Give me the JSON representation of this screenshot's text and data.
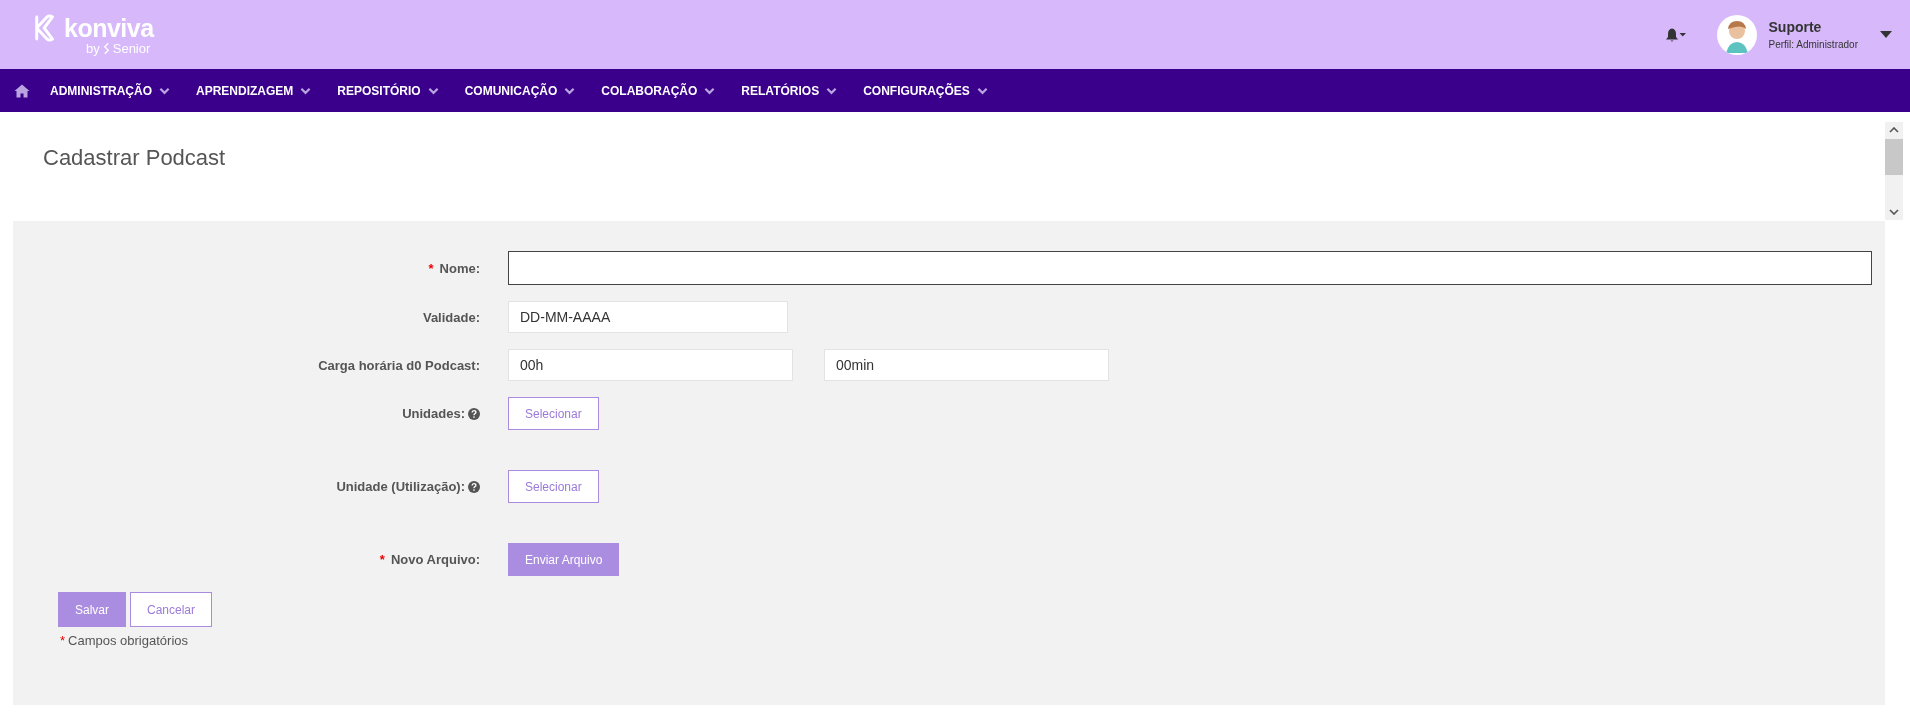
{
  "header": {
    "logo": {
      "name": "konviva",
      "by": "by",
      "brand": "Senior"
    },
    "user": {
      "name": "Suporte",
      "profile": "Perfil: Administrador"
    }
  },
  "nav": {
    "items": [
      {
        "label": "ADMINISTRAÇÃO"
      },
      {
        "label": "APRENDIZAGEM"
      },
      {
        "label": "REPOSITÓRIO"
      },
      {
        "label": "COMUNICAÇÃO"
      },
      {
        "label": "COLABORAÇÃO"
      },
      {
        "label": "RELATÓRIOS"
      },
      {
        "label": "CONFIGURAÇÕES"
      }
    ]
  },
  "page": {
    "title": "Cadastrar Podcast"
  },
  "form": {
    "rows": [
      {
        "kind": "text",
        "label": "Nome:",
        "marker": "*",
        "help": false
      },
      {
        "kind": "date",
        "label": "Validade:",
        "help": false,
        "fields": [
          "DD-MM-AAAA"
        ]
      },
      {
        "kind": "duration",
        "label": "Carga horária d0 Podcast:",
        "help": false,
        "fields": [
          "00h",
          "00min"
        ]
      },
      {
        "kind": "select",
        "label": "Unidades:",
        "help": true,
        "button": "Selecionar"
      },
      {
        "kind": "select",
        "label": "Unidade (Utilização):",
        "help": true,
        "button": "Selecionar"
      },
      {
        "kind": "file",
        "label": "Novo Arquivo:",
        "marker": "*",
        "help": false,
        "button": "Enviar Arquivo"
      }
    ],
    "actions": [
      {
        "label": "Salvar",
        "kind": "primary"
      },
      {
        "label": "Cancelar",
        "kind": "secondary"
      }
    ],
    "note": {
      "marker": "*",
      "text": "Campos obrigatórios"
    }
  }
}
